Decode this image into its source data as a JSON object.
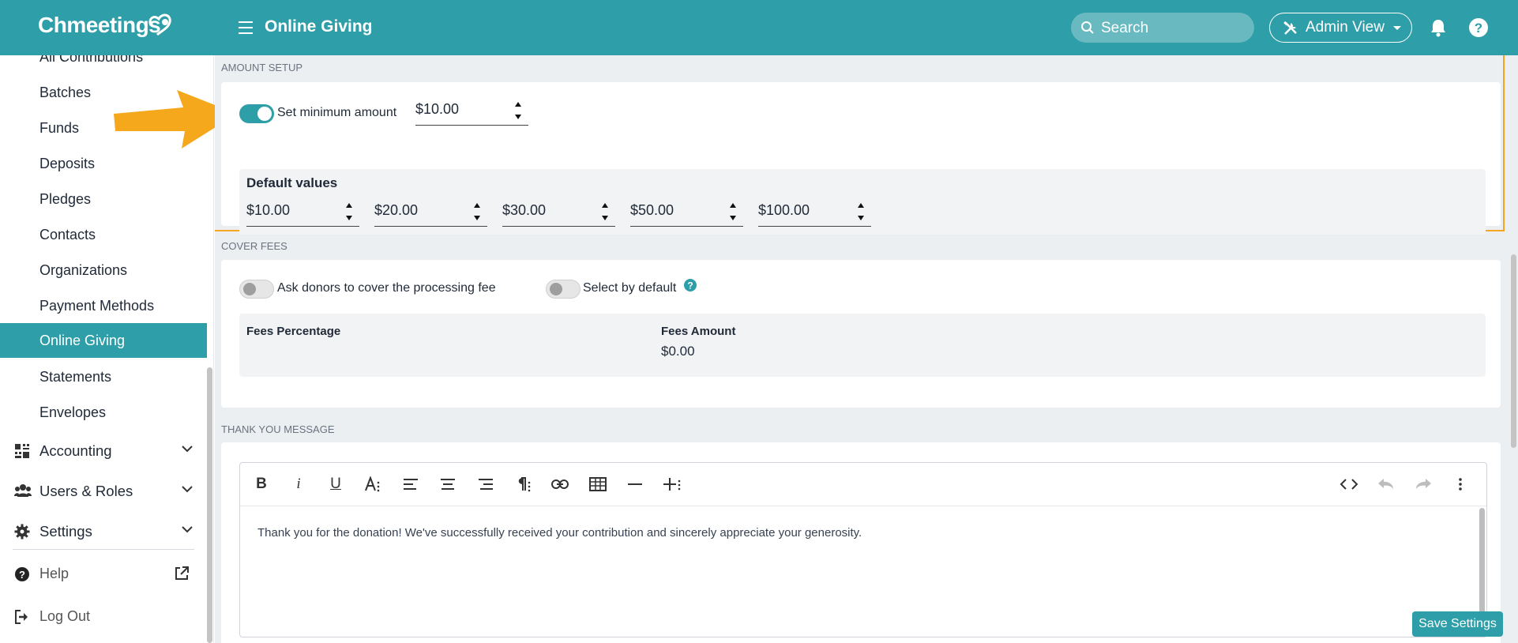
{
  "header": {
    "logo_text": "Chmeetings",
    "title": "Online Giving",
    "search_placeholder": "Search",
    "admin_view_label": "Admin View"
  },
  "sidebar": {
    "items": [
      {
        "label": "All Contributions"
      },
      {
        "label": "Batches"
      },
      {
        "label": "Funds"
      },
      {
        "label": "Deposits"
      },
      {
        "label": "Pledges"
      },
      {
        "label": "Contacts"
      },
      {
        "label": "Organizations"
      },
      {
        "label": "Payment Methods"
      },
      {
        "label": "Online Giving",
        "active": true
      },
      {
        "label": "Statements"
      },
      {
        "label": "Envelopes"
      }
    ],
    "groups": [
      {
        "label": "Accounting",
        "icon": "accounting-icon"
      },
      {
        "label": "Users & Roles",
        "icon": "users-icon"
      },
      {
        "label": "Settings",
        "icon": "gear-icon"
      }
    ],
    "help_label": "Help",
    "logout_label": "Log Out"
  },
  "amount_setup": {
    "section_label": "AMOUNT SETUP",
    "min_toggle_label": "Set minimum amount",
    "min_toggle_on": true,
    "min_amount": "$10.00",
    "defaults_title": "Default values",
    "defaults": [
      "$10.00",
      "$20.00",
      "$30.00",
      "$50.00",
      "$100.00"
    ]
  },
  "cover_fees": {
    "section_label": "COVER FEES",
    "ask_label": "Ask donors to cover the processing fee",
    "ask_on": false,
    "select_default_label": "Select by default",
    "select_default_on": false,
    "fees_percentage_label": "Fees Percentage",
    "fees_amount_label": "Fees Amount",
    "fees_amount_value": "$0.00"
  },
  "thank_you": {
    "section_label": "THANK YOU MESSAGE",
    "message": "Thank you for the donation! We've successfully received your contribution and sincerely appreciate your generosity."
  },
  "footer": {
    "save_label": "Save Settings"
  },
  "colors": {
    "brand": "#2e9ea8",
    "highlight": "#f5a623"
  }
}
